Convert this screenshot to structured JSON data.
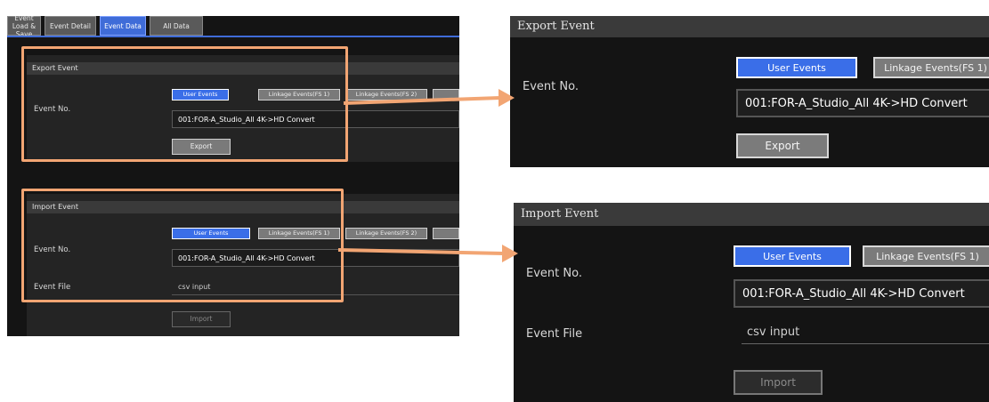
{
  "left": {
    "tabs": [
      {
        "label": "Event Load & Save",
        "active": false
      },
      {
        "label": "Event Detail",
        "active": false
      },
      {
        "label": "Event Data",
        "active": true
      },
      {
        "label": "All Data",
        "active": false
      }
    ],
    "export": {
      "title": "Export Event",
      "event_no_label": "Event No.",
      "buttons": [
        "User Events",
        "Linkage Events(FS 1)",
        "Linkage Events(FS 2)"
      ],
      "selected_event": "001:FOR-A_Studio_All 4K->HD Convert",
      "export_label": "Export"
    },
    "import": {
      "title": "Import Event",
      "event_no_label": "Event No.",
      "buttons": [
        "User Events",
        "Linkage Events(FS 1)",
        "Linkage Events(FS 2)"
      ],
      "selected_event": "001:FOR-A_Studio_All 4K->HD Convert",
      "event_file_label": "Event File",
      "file_placeholder": "csv input",
      "import_label": "Import"
    }
  },
  "zoom_export": {
    "title": "Export Event",
    "event_no_label": "Event No.",
    "user_events": "User Events",
    "linkage_fs1": "Linkage Events(FS 1)",
    "selected_event": "001:FOR-A_Studio_All 4K->HD Convert",
    "export_label": "Export"
  },
  "zoom_import": {
    "title": "Import Event",
    "event_no_label": "Event No.",
    "user_events": "User Events",
    "linkage_fs1": "Linkage Events(FS 1)",
    "selected_event": "001:FOR-A_Studio_All 4K->HD Convert",
    "event_file_label": "Event File",
    "file_placeholder": "csv input",
    "import_label": "Import"
  },
  "colors": {
    "highlight": "#f2a573",
    "accent_blue": "#3a6ee8",
    "panel_bg": "#141414"
  }
}
